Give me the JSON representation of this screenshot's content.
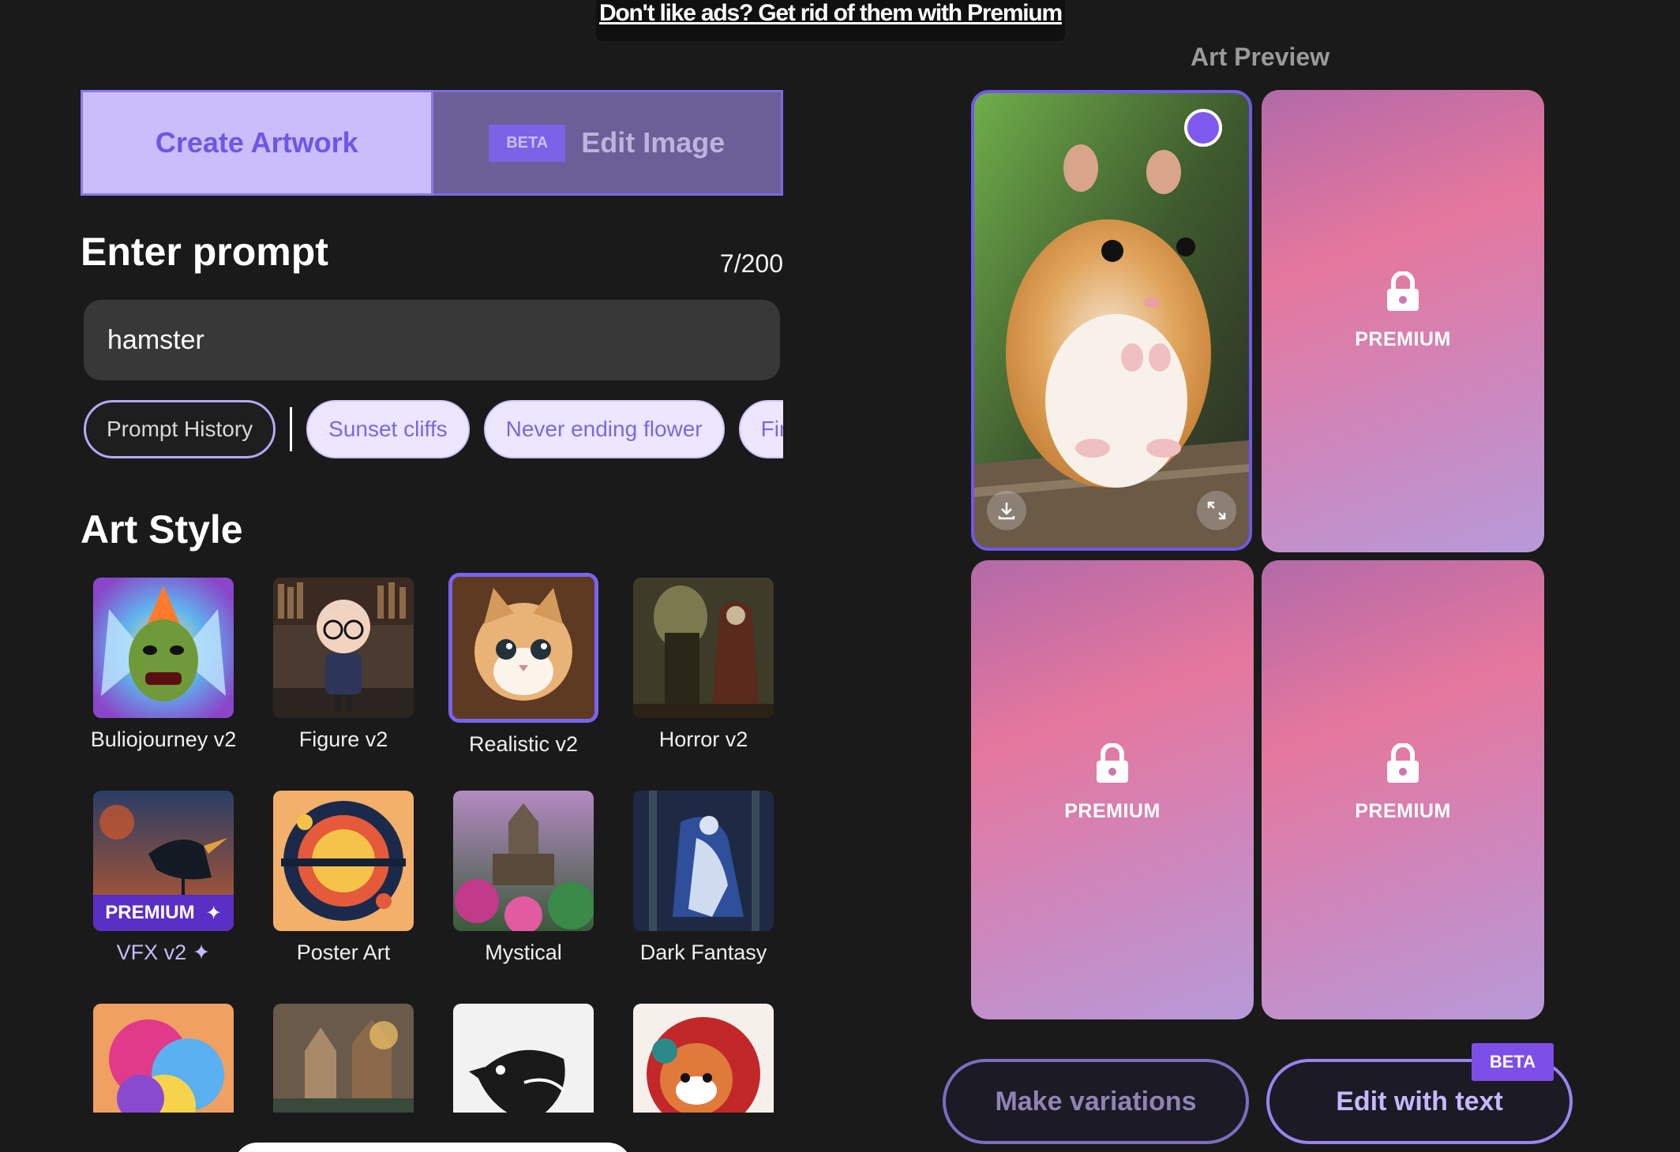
{
  "ad_banner": {
    "text": "Don't like ads? Get rid of them with Premium"
  },
  "tabs": {
    "create": "Create Artwork",
    "edit_beta": "BETA",
    "edit": "Edit Image"
  },
  "prompt": {
    "title": "Enter prompt",
    "count": "7/200",
    "value": "hamster"
  },
  "chips": {
    "history": "Prompt History",
    "suggestions": [
      "Sunset cliffs",
      "Never ending flower",
      "Fire and ice"
    ]
  },
  "art_style": {
    "title": "Art Style",
    "items": [
      {
        "label": "Buliojourney v2"
      },
      {
        "label": "Figure v2"
      },
      {
        "label": "Realistic v2",
        "selected": true
      },
      {
        "label": "Horror v2"
      },
      {
        "label": "VFX v2 ✦",
        "premium_badge": "PREMIUM"
      },
      {
        "label": "Poster Art"
      },
      {
        "label": "Mystical"
      },
      {
        "label": "Dark Fantasy"
      }
    ]
  },
  "preview": {
    "title": "Art Preview",
    "locked_label": "PREMIUM"
  },
  "actions": {
    "variations": "Make variations",
    "edit_text": "Edit with text",
    "beta": "BETA"
  },
  "colors": {
    "accent": "#7b62ef",
    "tab_active_bg": "#cbbcfb",
    "tab_inactive_bg": "#6c5f97"
  }
}
